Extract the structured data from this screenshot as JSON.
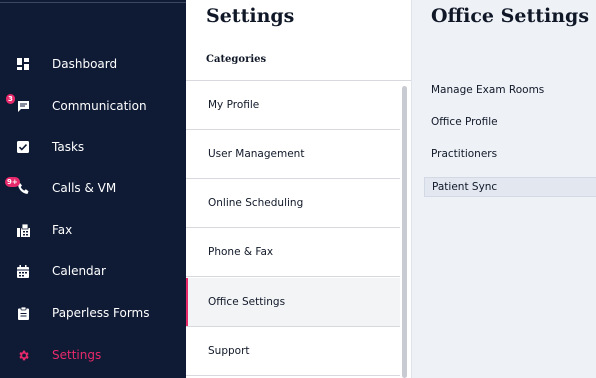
{
  "nav": {
    "items": [
      {
        "label": "Dashboard",
        "icon": "dashboard-icon"
      },
      {
        "label": "Communication",
        "icon": "chat-icon",
        "badge": "3"
      },
      {
        "label": "Tasks",
        "icon": "check-square-icon"
      },
      {
        "label": "Calls & VM",
        "icon": "phone-icon",
        "badge": "9+"
      },
      {
        "label": "Fax",
        "icon": "fax-icon"
      },
      {
        "label": "Calendar",
        "icon": "calendar-icon"
      },
      {
        "label": "Paperless Forms",
        "icon": "clipboard-icon"
      },
      {
        "label": "Settings",
        "icon": "gear-icon",
        "active": true
      }
    ]
  },
  "settings": {
    "title": "Settings",
    "categories_label": "Categories",
    "categories": [
      {
        "label": "My Profile"
      },
      {
        "label": "User Management"
      },
      {
        "label": "Online Scheduling"
      },
      {
        "label": "Phone & Fax"
      },
      {
        "label": "Office Settings",
        "active": true
      },
      {
        "label": "Support"
      }
    ]
  },
  "office_settings": {
    "title": "Office Settings",
    "items": [
      {
        "label": "Manage Exam Rooms"
      },
      {
        "label": "Office Profile"
      },
      {
        "label": "Practitioners"
      },
      {
        "label": "Patient Sync",
        "active": true
      }
    ]
  },
  "colors": {
    "nav_bg": "#0f1b35",
    "accent": "#e8296b",
    "panel_bg": "#eef1f6"
  }
}
